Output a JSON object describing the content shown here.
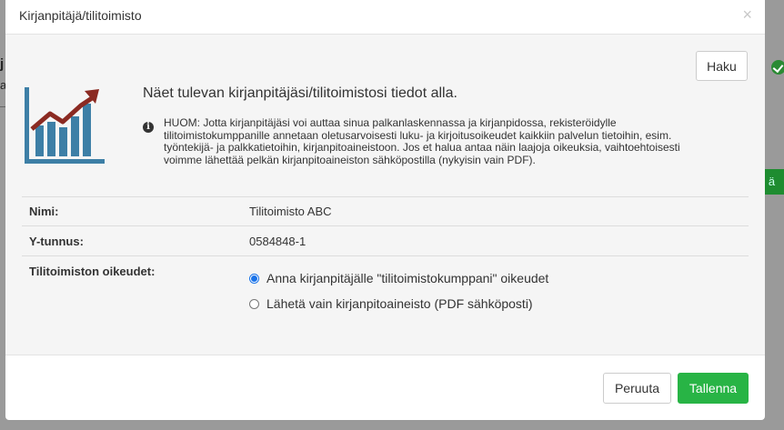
{
  "background": {
    "left_text": "j",
    "left_text2": "a",
    "right_button_fragment": "ä"
  },
  "modal": {
    "title": "Kirjanpitäjä/tilitoimisto",
    "close_symbol": "×",
    "search_button": "Haku",
    "intro": "Näet tulevan kirjanpitäjäsi/tilitoimistosi tiedot alla.",
    "notice_icon_glyph": "i",
    "notice": "HUOM: Jotta kirjanpitäjäsi voi auttaa sinua palkanlaskennassa ja kirjanpidossa, rekisteröidylle tilitoimistokumppanille annetaan oletusarvoisesti luku- ja kirjoitusoikeudet kaikkiin palvelun tietoihin, esim. työntekijä- ja palkkatietoihin, kirjanpitoaineistoon. Jos et halua antaa näin laajoja oikeuksia, vaihtoehtoisesti voimme lähettää pelkän kirjanpitoaineiston sähköpostilla (nykyisin vain PDF).",
    "rows": [
      {
        "label": "Nimi:",
        "value": "Tilitoimisto ABC"
      },
      {
        "label": "Y-tunnus:",
        "value": "0584848-1"
      }
    ],
    "rights_label": "Tilitoimiston oikeudet:",
    "rights_options": [
      {
        "label": "Anna kirjanpitäjälle \"tilitoimistokumppani\" oikeudet",
        "selected": true
      },
      {
        "label": "Lähetä vain kirjanpitoaineisto (PDF sähköposti)",
        "selected": false
      }
    ],
    "cancel_button": "Peruuta",
    "save_button": "Tallenna"
  },
  "colors": {
    "icon_blue": "#3d7fa6",
    "icon_red": "#8b2a22",
    "save_green": "#28b445",
    "radio_blue": "#1a73e8"
  }
}
